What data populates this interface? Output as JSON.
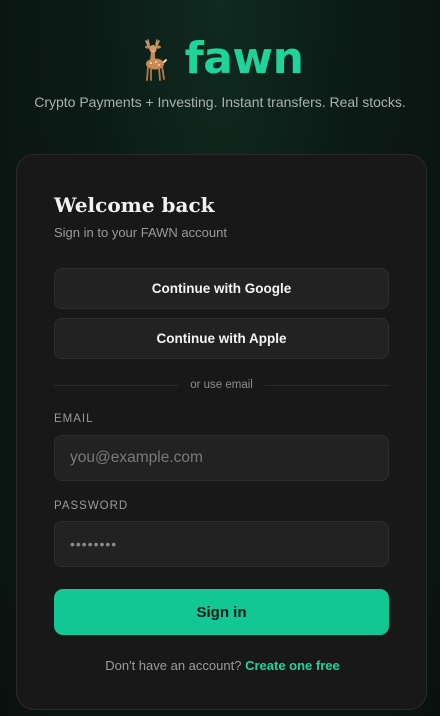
{
  "brand": {
    "name": "fawn",
    "logo_icon": "deer-icon",
    "tagline": "Crypto Payments + Investing. Instant transfers. Real stocks."
  },
  "card": {
    "title": "Welcome back",
    "subtitle": "Sign in to your FAWN account",
    "google_label": "Continue with Google",
    "apple_label": "Continue with Apple",
    "divider_text": "or use email",
    "email_label": "EMAIL",
    "email_placeholder": "you@example.com",
    "password_label": "PASSWORD",
    "password_value": "••••••••",
    "signin_label": "Sign in",
    "footer_text": "Don't have an account?",
    "footer_link": "Create one free"
  },
  "colors": {
    "accent": "#1fd49a",
    "button": "#13c795",
    "card_bg": "#181818",
    "page_bg": "#0b1a14"
  }
}
